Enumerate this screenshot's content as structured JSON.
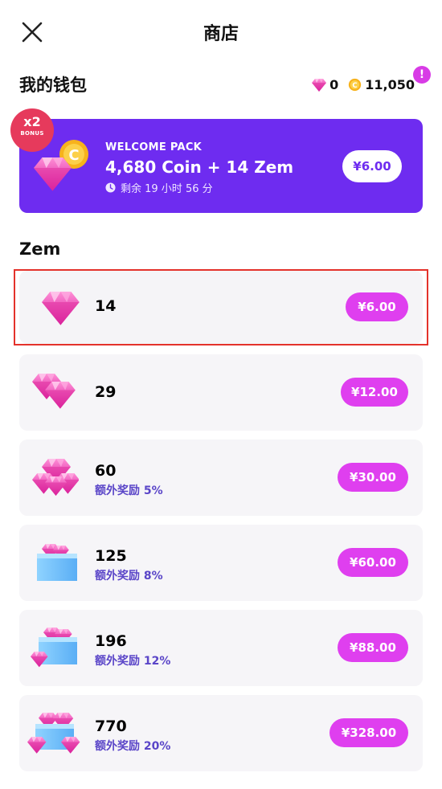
{
  "header": {
    "title": "商店"
  },
  "wallet": {
    "title": "我的钱包",
    "zem_balance": "0",
    "coin_balance": "11,050",
    "alert": "!"
  },
  "welcome_pack": {
    "badge_multiplier": "x2",
    "badge_label": "BONUS",
    "label": "WELCOME PACK",
    "contents": "4,680 Coin + 14 Zem",
    "timer": "剩余 19 小时 56 分",
    "price": "¥6.00"
  },
  "zem_section": {
    "title": "Zem",
    "items": [
      {
        "amount": "14",
        "bonus": "",
        "price": "¥6.00",
        "icon": "single-gem-icon"
      },
      {
        "amount": "29",
        "bonus": "",
        "price": "¥12.00",
        "icon": "double-gem-icon"
      },
      {
        "amount": "60",
        "bonus": "额外奖励 5%",
        "price": "¥30.00",
        "icon": "gem-pile-icon"
      },
      {
        "amount": "125",
        "bonus": "额外奖励 8%",
        "price": "¥60.00",
        "icon": "gem-box-icon"
      },
      {
        "amount": "196",
        "bonus": "额外奖励 12%",
        "price": "¥88.00",
        "icon": "gem-box-large-icon"
      },
      {
        "amount": "770",
        "bonus": "额外奖励 20%",
        "price": "¥328.00",
        "icon": "gem-chest-icon"
      }
    ]
  },
  "colors": {
    "accent_purple": "#6e2cf0",
    "price_pill": "#df3fef",
    "bonus_text": "#5a45c8",
    "selection_outline": "#e4322b",
    "bonus_badge": "#e63a5c"
  }
}
